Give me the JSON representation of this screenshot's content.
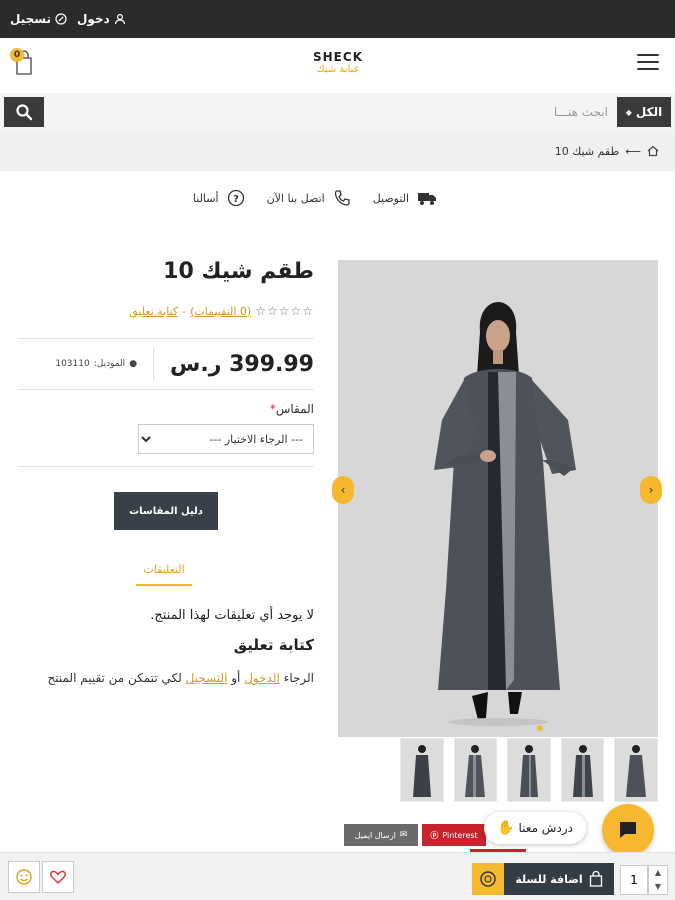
{
  "topbar": {
    "login": "دخول",
    "register": "تسجيل"
  },
  "header": {
    "logo_en": "SHECK",
    "logo_ar": "عباية شيك",
    "cart_count": "0"
  },
  "search": {
    "category": "الكل",
    "placeholder": "ابحث هنـــا"
  },
  "breadcrumb": {
    "separator": "⟵",
    "current": "طقم شيك 10"
  },
  "features": {
    "delivery": "التوصيل",
    "contact": "اتصل بنا الآن",
    "faq": "أسالنا"
  },
  "product": {
    "title": "طقم شيك 10",
    "reviews_link": "0 التقييمات",
    "write_review_link": "كتابة تعليق",
    "review_sep": "-",
    "price": "399.99 ر.س",
    "model_label": "الموديل:",
    "model_value": "103110",
    "size_label": "المقاس",
    "size_required": "*",
    "size_placeholder": "--- الرجاء الاختيار ---",
    "size_guide_button": "دليل المقاسات"
  },
  "comments": {
    "tab": "التعليقات",
    "empty": "لا يوجد أي تعليقات لهذا المنتج.",
    "write_title": "كتابة تعليق",
    "login_prefix": "الرجاء",
    "login_link": "الدخول",
    "or": "أو",
    "register_link": "التسجيل",
    "login_suffix": "لكي تتمكن من تقييم المنتج"
  },
  "share": {
    "email": "ارسال ايميل",
    "pinterest": "Pinterest"
  },
  "chat": {
    "label": "دردش معنا"
  },
  "bottombar": {
    "add_to_cart": "اضافة للسلة",
    "quantity": "1"
  },
  "colors": {
    "accent": "#f5b82e",
    "dark": "#2b2b2b",
    "button": "#3a4049"
  },
  "icons": [
    "user-icon",
    "login-icon",
    "menu-icon",
    "cart-icon",
    "search-icon",
    "home-icon",
    "truck-icon",
    "phone-icon",
    "question-icon",
    "chevron-left-icon",
    "chevron-right-icon",
    "chat-icon",
    "bag-icon",
    "coin-icon",
    "heart-icon",
    "smile-icon",
    "mail-icon",
    "pinterest-icon",
    "wave-icon"
  ]
}
